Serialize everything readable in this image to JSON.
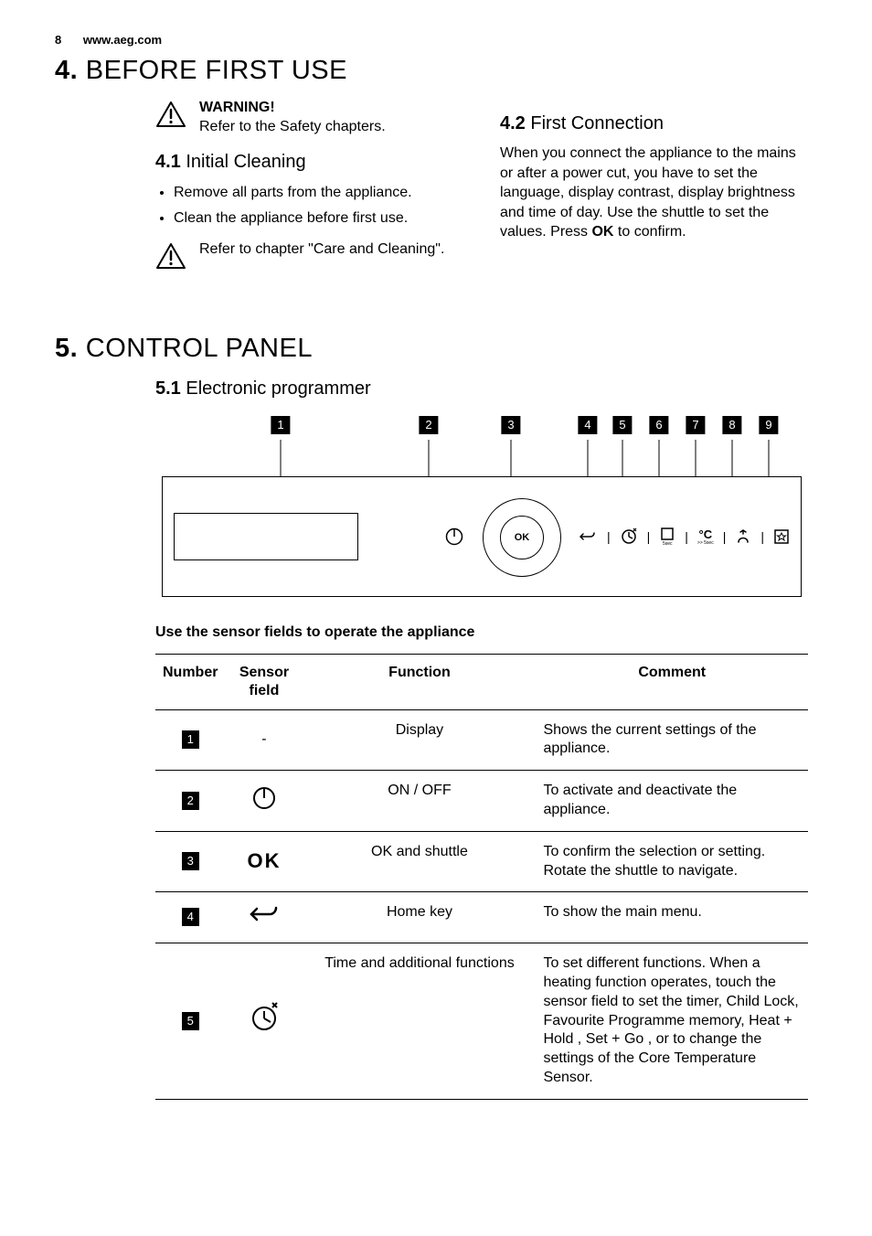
{
  "header": {
    "page_number": "8",
    "site": "www.aeg.com"
  },
  "sections": {
    "s4": {
      "num": "4.",
      "title": "BEFORE FIRST USE",
      "warning": {
        "label": "WARNING!",
        "text": "Refer to the Safety chapters."
      },
      "sub1": {
        "num": "4.1",
        "title": "Initial Cleaning",
        "bullets": [
          "Remove all parts from the appliance.",
          "Clean the appliance before first use."
        ],
        "note": "Refer to chapter \"Care and Cleaning\"."
      },
      "sub2": {
        "num": "4.2",
        "title": "First Connection",
        "body_pre": "When you connect the appliance to the mains or after a power cut, you have to set the language, display contrast, display brightness and time of day. Use the shuttle to set the values. Press ",
        "body_bold": "OK",
        "body_post": " to confirm."
      }
    },
    "s5": {
      "num": "5.",
      "title": "CONTROL PANEL",
      "sub1": {
        "num": "5.1",
        "title": "Electronic programmer"
      },
      "ok_label": "OK",
      "table_caption": "Use the sensor fields to operate the appliance",
      "table": {
        "headers": {
          "number": "Number",
          "sensor": "Sensor field",
          "function": "Function",
          "comment": "Comment"
        },
        "rows": [
          {
            "n": "1",
            "sensor": "-",
            "fn": "Display",
            "comment": "Shows the current settings of the appliance."
          },
          {
            "n": "2",
            "sensor_icon": "power",
            "fn": "ON / OFF",
            "comment": "To activate and deactivate the appliance."
          },
          {
            "n": "3",
            "sensor_text": "OK",
            "fn": "OK and shuttle",
            "comment": "To confirm the selection or setting. Rotate the shuttle to navigate."
          },
          {
            "n": "4",
            "sensor_icon": "home",
            "fn": "Home key",
            "comment": "To show the main menu."
          },
          {
            "n": "5",
            "sensor_icon": "clock",
            "fn": "Time and additional functions",
            "comment": "To set different functions. When a heating function operates, touch the sensor field to set the timer, Child Lock, Favourite Programme memory, Heat + Hold , Set + Go , or to change the settings of the Core Temperature Sensor."
          }
        ]
      }
    }
  }
}
